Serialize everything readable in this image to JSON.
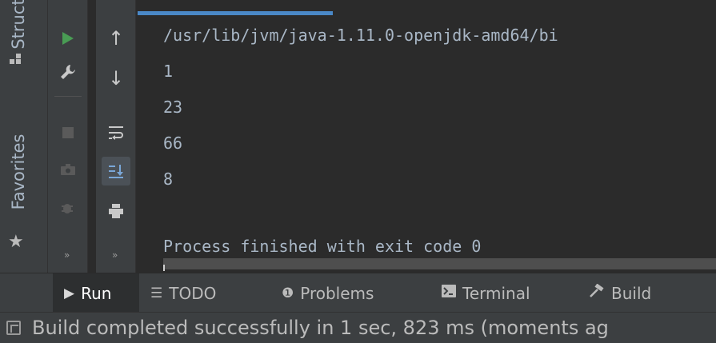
{
  "side_strip": {
    "structure_label": "Struct",
    "favorites_label": "Favorites",
    "more_glyph": "»"
  },
  "toolbar": {
    "col1_more_glyph": "»",
    "col2_more_glyph": "»"
  },
  "console": {
    "lines": [
      "/usr/lib/jvm/java-1.11.0-openjdk-amd64/bi",
      "1",
      "23",
      "66",
      "8",
      "",
      "Process finished with exit code 0"
    ]
  },
  "bottom_tabs": [
    {
      "label": "Run",
      "selected": true
    },
    {
      "label": "TODO",
      "selected": false
    },
    {
      "label": "Problems",
      "selected": false
    },
    {
      "label": "Terminal",
      "selected": false
    },
    {
      "label": "Build",
      "selected": false
    }
  ],
  "status_bar": {
    "message": "Build completed successfully in 1 sec, 823 ms (moments ag"
  },
  "colors": {
    "background": "#2b2b2b",
    "panel": "#3c3f41",
    "run_green": "#499c54",
    "accent_blue": "#4a88c7",
    "text": "#a9b7c6"
  }
}
